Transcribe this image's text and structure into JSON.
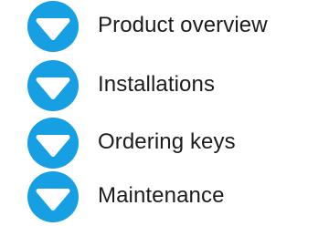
{
  "accent_color": "#169fe3",
  "icon_name": "chevron-down-icon",
  "menu": {
    "items": [
      {
        "label": "Product overview"
      },
      {
        "label": "Installations"
      },
      {
        "label": "Ordering keys"
      },
      {
        "label": "Maintenance"
      }
    ]
  }
}
